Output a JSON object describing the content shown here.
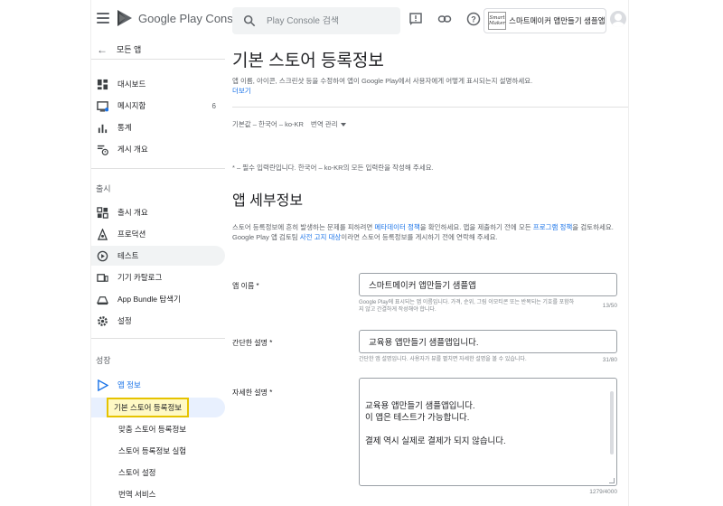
{
  "header": {
    "brand": "Google Play Console",
    "search_placeholder": "Play Console 검색",
    "app_thumb": "Smart Maker",
    "app_name": "스마트메이커 앱만들기 샘플앱"
  },
  "sidebar": {
    "back_label": "모든 앱",
    "items": [
      {
        "label": "대시보드",
        "icon": "dashboard-icon"
      },
      {
        "label": "메시지함",
        "icon": "inbox-icon",
        "count": "6"
      },
      {
        "label": "통계",
        "icon": "stats-icon"
      },
      {
        "label": "게시 개요",
        "icon": "publishing-overview-icon"
      }
    ],
    "release_section": "출시",
    "release_items": [
      {
        "label": "출시 개요",
        "icon": "release-overview-icon"
      },
      {
        "label": "프로덕션",
        "icon": "production-icon"
      },
      {
        "label": "테스트",
        "icon": "testing-icon"
      },
      {
        "label": "기기 카탈로그",
        "icon": "device-catalog-icon"
      },
      {
        "label": "App Bundle 탐색기",
        "icon": "app-bundle-icon"
      },
      {
        "label": "설정",
        "icon": "settings-icon"
      }
    ],
    "grow_section": "성장",
    "grow_item": {
      "label": "앱 정보",
      "icon": "play-store-icon"
    },
    "sub_items": [
      "기본 스토어 등록정보",
      "맞춤 스토어 등록정보",
      "스토어 등록정보 실험",
      "스토어 설정",
      "번역 서비스"
    ]
  },
  "main": {
    "title": "기본 스토어 등록정보",
    "description": "앱 이름, 아이콘, 스크린샷 등을 수정하여 앱이 Google Play에서 사용자에게 어떻게 표시되는지 설명하세요.",
    "learn_more": "더보기",
    "locale": "기본값 – 한국어 – ko-KR",
    "manage_translations": "번역 관리",
    "required_note": "* – 필수 입력란입니다. 한국어 – ko-KR의 모든 입력란을 작성해 주세요.",
    "section_title": "앱 세부정보",
    "section_desc_1": "스토어 등록정보에 흔히 발생하는 문제를 피하려면 ",
    "section_desc_link1": "메타데이터 정책",
    "section_desc_2": "을 확인하세요. 앱을 제출하기 전에 모든 ",
    "section_desc_link2": "프로그램 정책",
    "section_desc_3": "을 검토하세요. Google Play 앱 검토팀 ",
    "section_desc_link3": "사전 고지 대상",
    "section_desc_4": "이라면 스토어 등록정보를 게시하기 전에 연락해 주세요.",
    "fields": {
      "app_name": {
        "label": "앱 이름 *",
        "value": "스마트메이커 앱만들기 샘플앱",
        "help": "Google Play에 표시되는 앱 이름입니다. 가격, 순위, 그림 이모티콘 또는 반복되는 기호를 포함하지 않고 간결하게 작성해야 합니다.",
        "count": "13/50"
      },
      "short_desc": {
        "label": "간단한 설명 *",
        "value": "교육용 앱만들기 샘플앱입니다.",
        "help": "간단한 앱 설명입니다. 사용자가 뷰를 펼치면 자세한 설명을 볼 수 있습니다.",
        "count": "31/80"
      },
      "full_desc": {
        "label": "자세한 설명 *",
        "lines": [
          "교육용 앱만들기 샘플앱입니다.",
          "이 앱은 테스트가 가능합니다.",
          "",
          "결제 역시 실제로 결제가 되지 않습니다."
        ],
        "count": "1279/4000"
      }
    }
  },
  "colors": {
    "accent": "#1a73e8",
    "highlight_border": "#e6c300",
    "highlight_fill": "#fff9c4"
  }
}
